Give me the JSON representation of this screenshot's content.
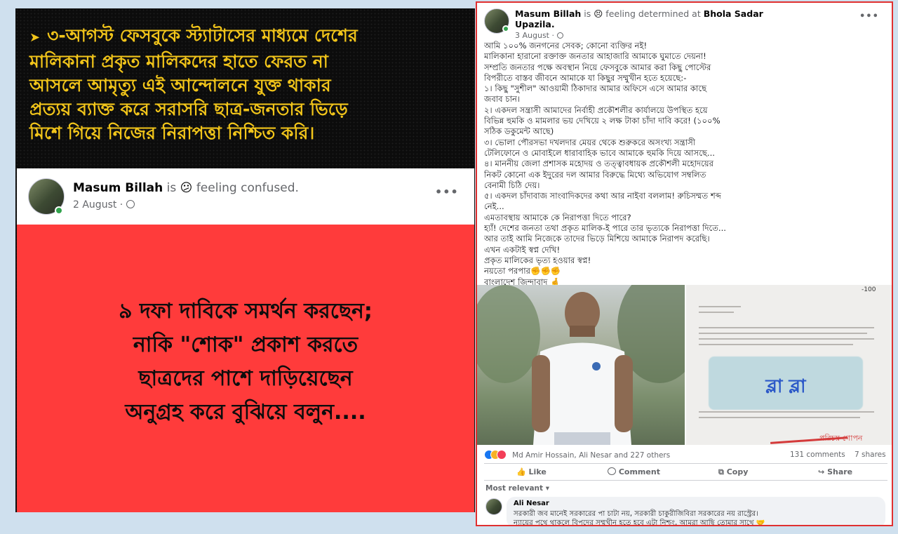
{
  "left": {
    "headline_lines": [
      "৩-আগস্ট ফেসবুকে স্ট্যাটাসের মাধ্যমে দেশের",
      "মালিকানা প্রকৃত মালিকদের হাতে ফেরত না",
      "আসলে আমৃত্যু এই আন্দোলনে যুক্ত থাকার",
      "প্রত্যয় ব্যাক্ত করে সরাসরি ছাত্র-জনতার ভিড়ে",
      "মিশে গিয়ে নিজের নিরাপত্তা নিশ্চিত করি।"
    ],
    "bullet": "➤",
    "post": {
      "name": "Masum Billah",
      "is_word": "is",
      "feeling_emoji": "😕",
      "feeling": "feeling confused.",
      "date": "2 August",
      "audience_icon": "globe-icon",
      "more": "•••"
    },
    "red_text_lines": [
      "৯ দফা দাবিকে সমর্থন করছেন;",
      "নাকি \"শোক\" প্রকাশ করতে",
      "ছাত্রদের পাশে দাড়িয়েছেন",
      "অনুগ্রহ করে বুঝিয়ে বলুন...."
    ],
    "red_bg": "#ff3b3b",
    "headline_color": "#f2c51a"
  },
  "right": {
    "name": "Masum Billah",
    "is_word": "is",
    "feeling_emoji": "😣",
    "feeling": "feeling determined at",
    "place_line1": "Bhola Sadar",
    "place_line2": "Upazila.",
    "date": "3 August",
    "audience_icon": "globe-icon",
    "more": "•••",
    "body_lines": [
      "আমি ১০০%  জনগনের সেবক; কোনো ব্যক্তির নই!",
      "মালিকানা হারানো রক্তাক্ত জনতার আহাজারি আমাকে ঘুমাতে দেয়না!",
      "সম্প্রতি জনতার পক্ষে অবস্থান নিয়ে ফেসবুকে আমার করা কিছু পোস্টের",
      "বিপরীতে বাস্তব জীবনে আমাকে যা কিছুর সম্মুখীন হতে হয়েছে:-",
      "১। কিছু \"সুশীল\" আওয়ামী ঠিকাদার আমার অফিসে এসে আমার কাছে",
      "জবাব চান।",
      "২। একদল সন্ত্রাসী আমাদের নির্বাহী প্রকৌশলীর কার্যালয়ে উপস্থিত হয়ে",
      "বিভিন্ন হুমকি ও মামলার ভয় দেখিয়ে ২ লক্ষ টাকা চাঁদা দাবি করে! (১০০%",
      "সঠিক ডকুমেন্ট আছে)",
      "৩। ভোলা পৌরসভা দখলদার মেয়র থেকে শুরুকরে অসংখ্য সন্ত্রাসী",
      "টেলিফোনে ও মোবাইলে ধারাবাহিক ভাবে আমাকে হুমকি দিয়ে আসছে...",
      "৪। মাননীয় জেলা প্রশাসক মহোদয় ও তত্ত্বাবধায়ক প্রকৌশলী মহোদয়ের",
      "নিকট কোনো এক ইদুরের দল আমার বিরুদ্ধে মিথ্যে অভিযোগ সম্বলিত",
      "বেনামী  চিঠি দেয়।",
      "৫। একদল চাঁদাবাজ সাংবাদিকদের কথা আর নাইবা বললাম! রুচিসম্মত শব্দ",
      "নেই...",
      "এমতাবস্থায় আমাকে কে নিরাপত্তা দিতে পারে?",
      "হ্যাঁ! দেশের জনতা তথা প্রকৃত মালিক-ই পারে তার ভৃত্যকে নিরাপত্তা দিতে...",
      "আর তাই আমি নিজেকে তাদের ভিড়ে মিশিয়ে আমাকে নিরাপদ করেছি।",
      "এখন একটাই স্বপ্ন দেখি!",
      "প্রকৃত মালিকের ভৃত্য হওয়ার স্বপ্ন!",
      "নয়তো পরপার✊✊✊",
      "বাংলাদেশ জিন্দাবাদ 🤞"
    ],
    "doc_overlay_text": "ব্লা ব্লা",
    "doc_stamp": "পরিচয় গোপন",
    "doc_corner": "-100",
    "reactions_text": "Md Amir Hossain, Ali Nesar and 227 others",
    "comments": "131 comments",
    "shares": "7 shares",
    "actions": {
      "like": "Like",
      "comment": "Comment",
      "copy": "Copy",
      "share": "Share"
    },
    "sort_label": "Most relevant",
    "comment_author": "Ali Nesar",
    "comment_lines": [
      "সরকারী জব মানেই সরকারের পা চাটা নয়, সরকারী চাকুরীজিবিরা সরকারের নয় রাস্ট্রের।",
      "ন্যায়ের পথে থাকলে বিপদের সম্মুখীন হতে হবে এটা নিশ্চং, আমরা আছি তোমার সাথে 🤝"
    ],
    "colors": {
      "like_blue": "#1877f2",
      "love_red": "#f33e58",
      "haha_yellow": "#f7b125",
      "border_red": "#e03030"
    }
  }
}
